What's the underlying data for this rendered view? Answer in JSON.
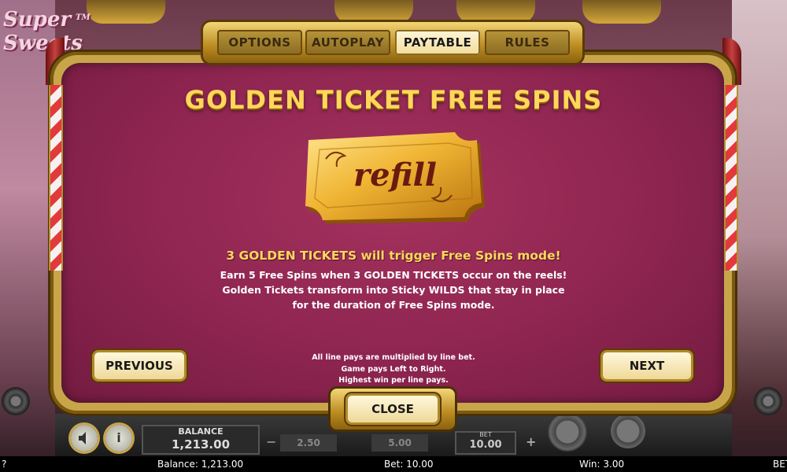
{
  "game": {
    "logo_text": "Super Sweets",
    "trademark": "TM"
  },
  "tabs": [
    {
      "label": "OPTIONS",
      "active": false
    },
    {
      "label": "AUTOPLAY",
      "active": false
    },
    {
      "label": "PAYTABLE",
      "active": true
    },
    {
      "label": "RULES",
      "active": false
    }
  ],
  "paytable": {
    "title": "GOLDEN TICKET FREE SPINS",
    "ticket_text": "refill",
    "headline": "3 GOLDEN TICKETS will trigger Free Spins mode!",
    "description": [
      "Earn 5 Free Spins when 3 GOLDEN TICKETS occur on the reels!",
      "Golden Tickets transform into Sticky WILDS that stay in place",
      "for the duration of Free Spins mode."
    ],
    "notes": [
      "All line pays are multiplied by line bet.",
      "Game pays Left to Right.",
      "Highest win per line pays."
    ]
  },
  "buttons": {
    "previous": "PREVIOUS",
    "next": "NEXT",
    "close": "CLOSE"
  },
  "controls": {
    "sound_icon": "speaker-icon",
    "info_icon": "info-icon",
    "info_glyph": "i",
    "balance_label": "BALANCE",
    "balance_value": "1,213.00",
    "bet_minus": "−",
    "bet_plus": "+",
    "bet_options": [
      "2.50",
      "5.00"
    ],
    "bet_label": "BET",
    "bet_value": "10.00"
  },
  "status_bar": {
    "left": "?",
    "balance": "Balance: 1,213.00",
    "bet": "Bet: 10.00",
    "win": "Win: 3.00",
    "brand": "BET"
  },
  "colors": {
    "panel": "#8e2550",
    "gold": "#ffd75a",
    "frame": "#c9a54a"
  }
}
